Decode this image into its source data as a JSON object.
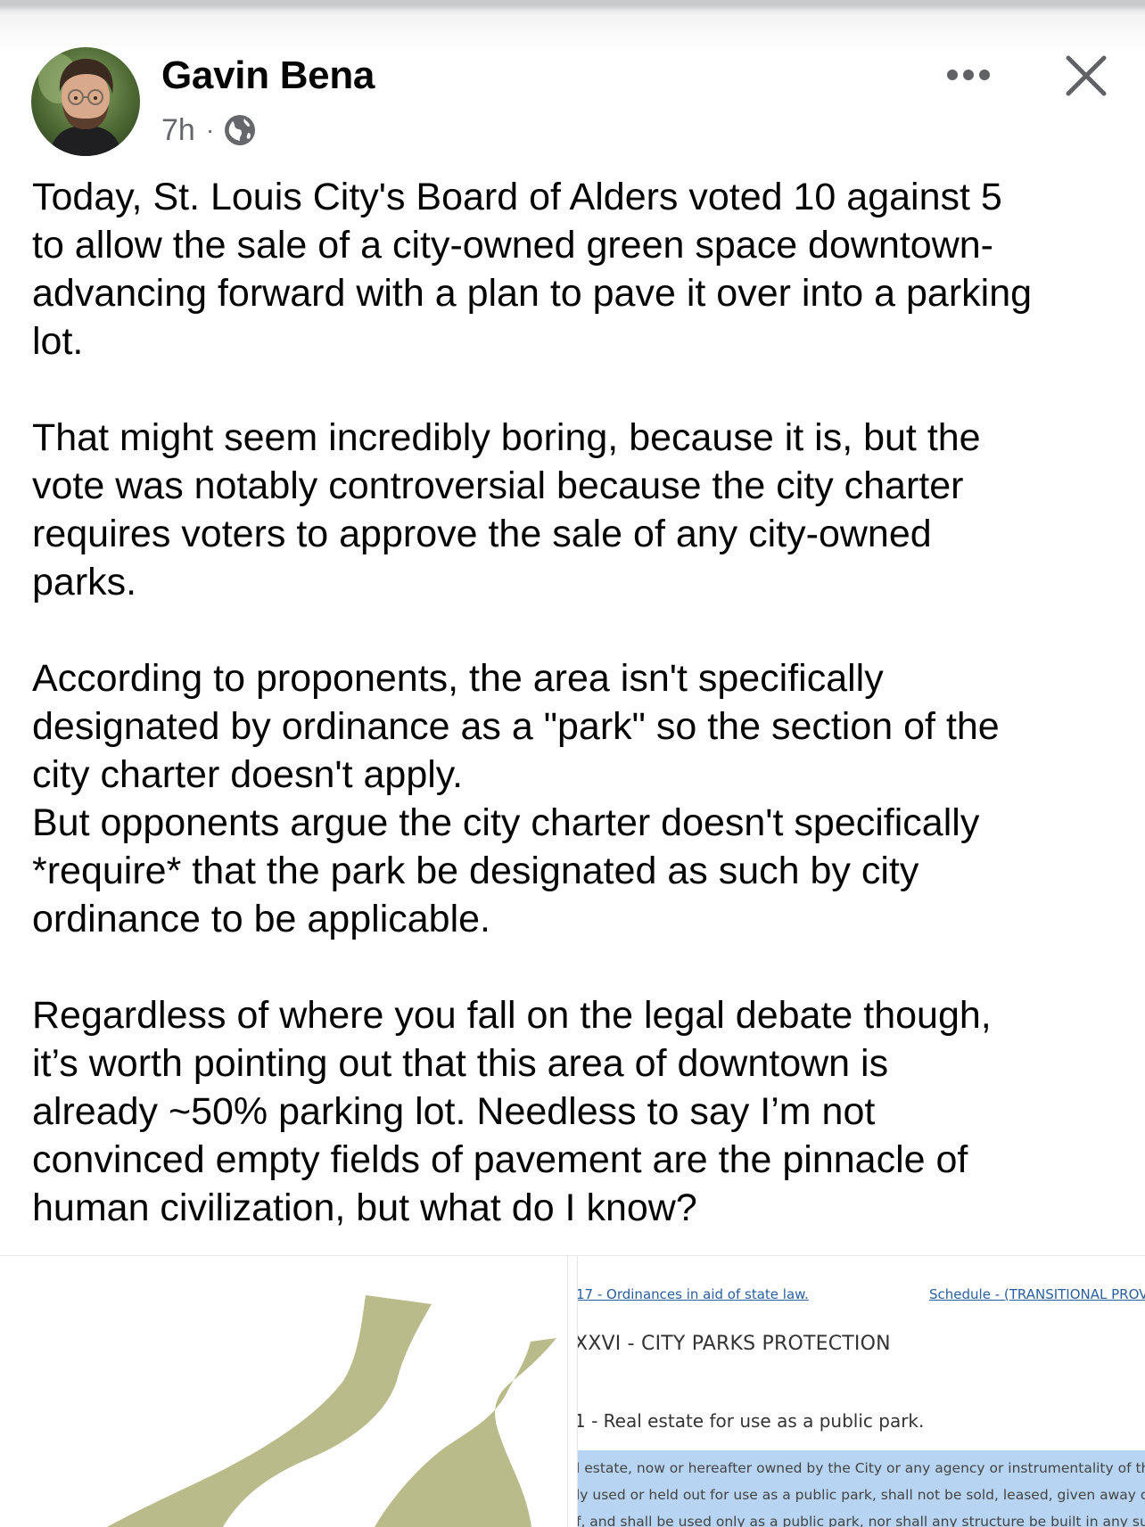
{
  "post": {
    "author": "Gavin Bena",
    "time": "7h",
    "separator": "·",
    "privacy_icon": "globe-icon",
    "text": "Today, St. Louis City's Board of Alders voted 10 against 5\nto allow the sale of a city-owned green space downtown-\nadvancing forward with a plan to pave it over into a parking\nlot.\n\nThat might seem incredibly boring, because it is, but the\nvote was notably controversial because the city charter\nrequires voters to approve the sale of any city-owned\nparks.\n\nAccording to proponents, the area isn't specifically\ndesignated by ordinance as a \"park\" so the section of the\ncity charter doesn't apply.\nBut opponents argue the city charter doesn't specifically\n*require* that the park be designated as such by city\nordinance to be applicable.\n\nRegardless of where you fall on the legal debate though,\nit’s worth pointing out that this area of downtown is\nalready ~50% parking lot. Needless to say I’m not\nconvinced empty fields of pavement are the pinnacle of\nhuman civilization, but what do I know?"
  },
  "header_actions": {
    "more_icon": "more-horizontal-icon",
    "close_icon": "close-icon"
  },
  "attachments": {
    "map": {
      "fill_color": "#b9bb8a"
    },
    "document": {
      "link_left": "17 - Ordinances in aid of state law.",
      "link_right": "Schedule - (TRANSITIONAL PROV",
      "heading": "XXVI - CITY PARKS PROTECTION",
      "section": "1 - Real estate for use as a public park.",
      "highlighted_lines": [
        "l estate, now or hereafter owned by the City or any agency or instrumentality of the",
        "ly used or held out for use as a public park, shall not be sold, leased, given away or",
        "f, and shall be used only as a public park, nor shall any structure be built in any such"
      ]
    }
  },
  "colors": {
    "text": "#050505",
    "secondary_text": "#65676b",
    "link": "#2a5f9e",
    "highlight": "#b7d4f2",
    "park_fill": "#b9bb8a"
  }
}
